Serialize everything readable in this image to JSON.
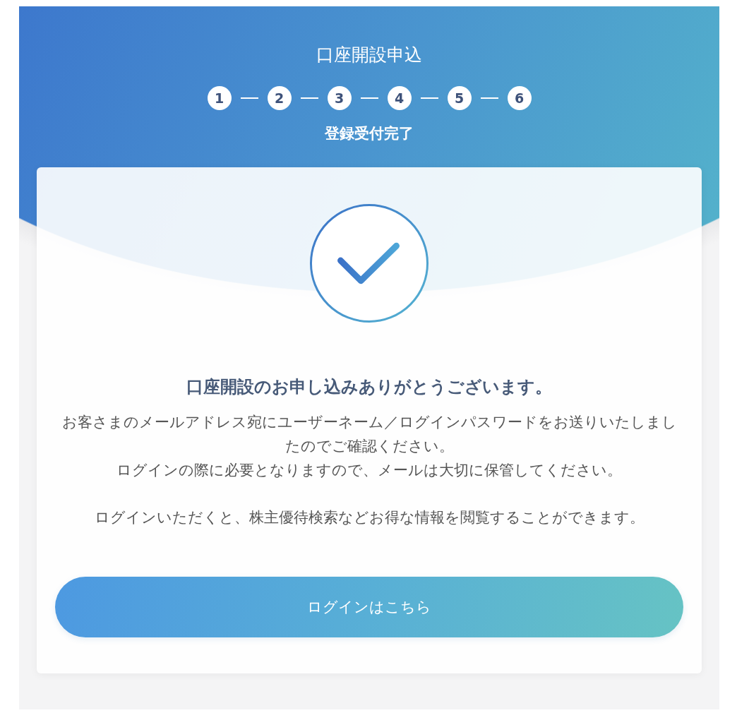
{
  "header": {
    "title": "口座開設申込",
    "steps": [
      {
        "number": "1"
      },
      {
        "number": "2"
      },
      {
        "number": "3"
      },
      {
        "number": "4"
      },
      {
        "number": "5"
      },
      {
        "number": "6"
      }
    ],
    "step_label": "登録受付完了"
  },
  "card": {
    "heading": "口座開設のお申し込みありがとうございます。",
    "message_lines": [
      "お客さまのメールアドレス宛にユーザーネーム／ログインパスワードをお送りいたしましたのでご確認ください。",
      "ログインの際に必要となりますので、メールは大切に保管してください。"
    ],
    "note": "ログインいただくと、株主優待検索などお得な情報を閲覧することができます。",
    "button": "ログインはこちら"
  }
}
